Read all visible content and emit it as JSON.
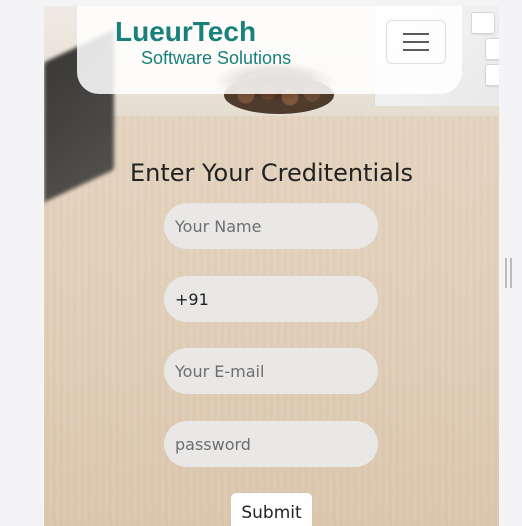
{
  "brand": {
    "name": "LueurTech",
    "tagline": "Software Solutions"
  },
  "nav": {
    "toggler_icon": "hamburger-icon"
  },
  "form": {
    "title": "Enter Your Creditentials",
    "name_placeholder": "Your Name",
    "phone_value": "+91",
    "email_placeholder": "Your E-mail",
    "password_placeholder": "password",
    "submit_label": "Submit"
  },
  "colors": {
    "brand": "#19807a",
    "field_bg": "#e9e8e7",
    "header_bg": "#ffffff"
  }
}
